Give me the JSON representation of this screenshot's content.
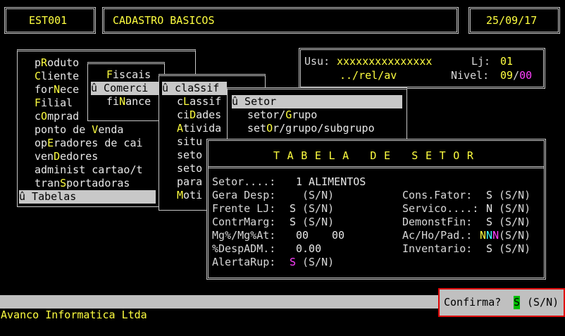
{
  "header": {
    "code": "EST001",
    "title": "CADASTRO BASICOS",
    "date": "25/09/17"
  },
  "user_panel": {
    "usu_label": "Usu:",
    "usu_value": "xxxxxxxxxxxxxxx",
    "lj_label": "Lj:",
    "lj_value": "01",
    "path": "../rel/av",
    "nivel_label": "Nivel:",
    "nivel_a": "09",
    "nivel_sep": "/",
    "nivel_b": "00"
  },
  "main_menu": {
    "items": [
      {
        "pre": "p",
        "hot": "R",
        "post": "oduto"
      },
      {
        "pre": "",
        "hot": "C",
        "post": "liente"
      },
      {
        "pre": "for",
        "hot": "N",
        "post": "ece"
      },
      {
        "pre": "",
        "hot": "F",
        "post": "ilial"
      },
      {
        "pre": "c",
        "hot": "O",
        "post": "mprad"
      },
      {
        "pre": "ponto de ",
        "hot": "V",
        "post": "enda"
      },
      {
        "pre": "op",
        "hot": "E",
        "post": "radores de cai"
      },
      {
        "pre": "ven",
        "hot": "D",
        "post": "edores"
      },
      {
        "pre": "administ cartao/t",
        "hot": "",
        "post": ""
      },
      {
        "pre": "tran",
        "hot": "S",
        "post": "portadoras"
      }
    ],
    "selected": "û Tabelas"
  },
  "tabelas_menu": {
    "items": [
      {
        "pre": "",
        "hot": "F",
        "post": "iscais"
      },
      {
        "pre": "fi",
        "hot": "N",
        "post": "ance"
      }
    ],
    "selected": "û Comerci"
  },
  "comercial_menu": {
    "selected": "û claSsif",
    "items": [
      {
        "pre": "c",
        "hot": "L",
        "post": "assif"
      },
      {
        "pre": "ci",
        "hot": "D",
        "post": "ades"
      },
      {
        "pre": "",
        "hot": "A",
        "post": "tivida"
      },
      {
        "pre": "situ",
        "hot": "",
        "post": ""
      },
      {
        "pre": "seto",
        "hot": "",
        "post": ""
      },
      {
        "pre": "seto",
        "hot": "",
        "post": ""
      },
      {
        "pre": "para",
        "hot": "",
        "post": ""
      },
      {
        "pre": "",
        "hot": "M",
        "post": "oti"
      }
    ]
  },
  "classif_menu": {
    "selected": "û Setor",
    "items": [
      {
        "pre": "setor/",
        "hot": "G",
        "post": "rupo"
      },
      {
        "pre": "set",
        "hot": "O",
        "post": "r/grupo/subgrupo"
      }
    ]
  },
  "setor_form": {
    "title": "TABELA DE SETOR",
    "setor_label": "Setor....:",
    "setor_value": "1 ALIMENTOS",
    "gera_desp_label": "Gera Desp:",
    "gera_desp_value": "",
    "gera_desp_opts": "(S/N)",
    "frente_label": "Frente LJ:",
    "frente_value": "S",
    "frente_opts": "(S/N)",
    "contr_label": "ContrMarg:",
    "contr_value": "S",
    "contr_opts": "(S/N)",
    "mg_label": "Mg%/Mg%At:",
    "mg_value1": "00",
    "mg_value2": "00",
    "desp_label": "%DespADM.:",
    "desp_value": "0.00",
    "alerta_label": "AlertaRup:",
    "alerta_value": "S",
    "alerta_opts": "(S/N)",
    "cons_label": "Cons.Fator:",
    "cons_value": "S",
    "cons_opts": "(S/N)",
    "servico_label": "Servico....:",
    "servico_value": "N",
    "servico_opts": "(S/N)",
    "demonst_label": "DemonstFin:",
    "demonst_value": "S",
    "demonst_opts": "(S/N)",
    "achopad_label": "Ac/Ho/Pad.:",
    "achopad_v1": "N",
    "achopad_v2": "N",
    "achopad_v3": "N",
    "achopad_opts": "(S/N)",
    "invent_label": "Inventario:",
    "invent_value": "S",
    "invent_opts": "(S/N)"
  },
  "confirm": {
    "label": "Confirma?",
    "value": "S",
    "opts": "(S/N)"
  },
  "footer": {
    "company": "Avanco Informatica Ltda"
  },
  "colors": {
    "yellow": "#ffff40",
    "magenta": "#ff40ff",
    "cyan": "#40ffff",
    "green_cursor": "#00c000",
    "confirm_border": "#e00000"
  }
}
